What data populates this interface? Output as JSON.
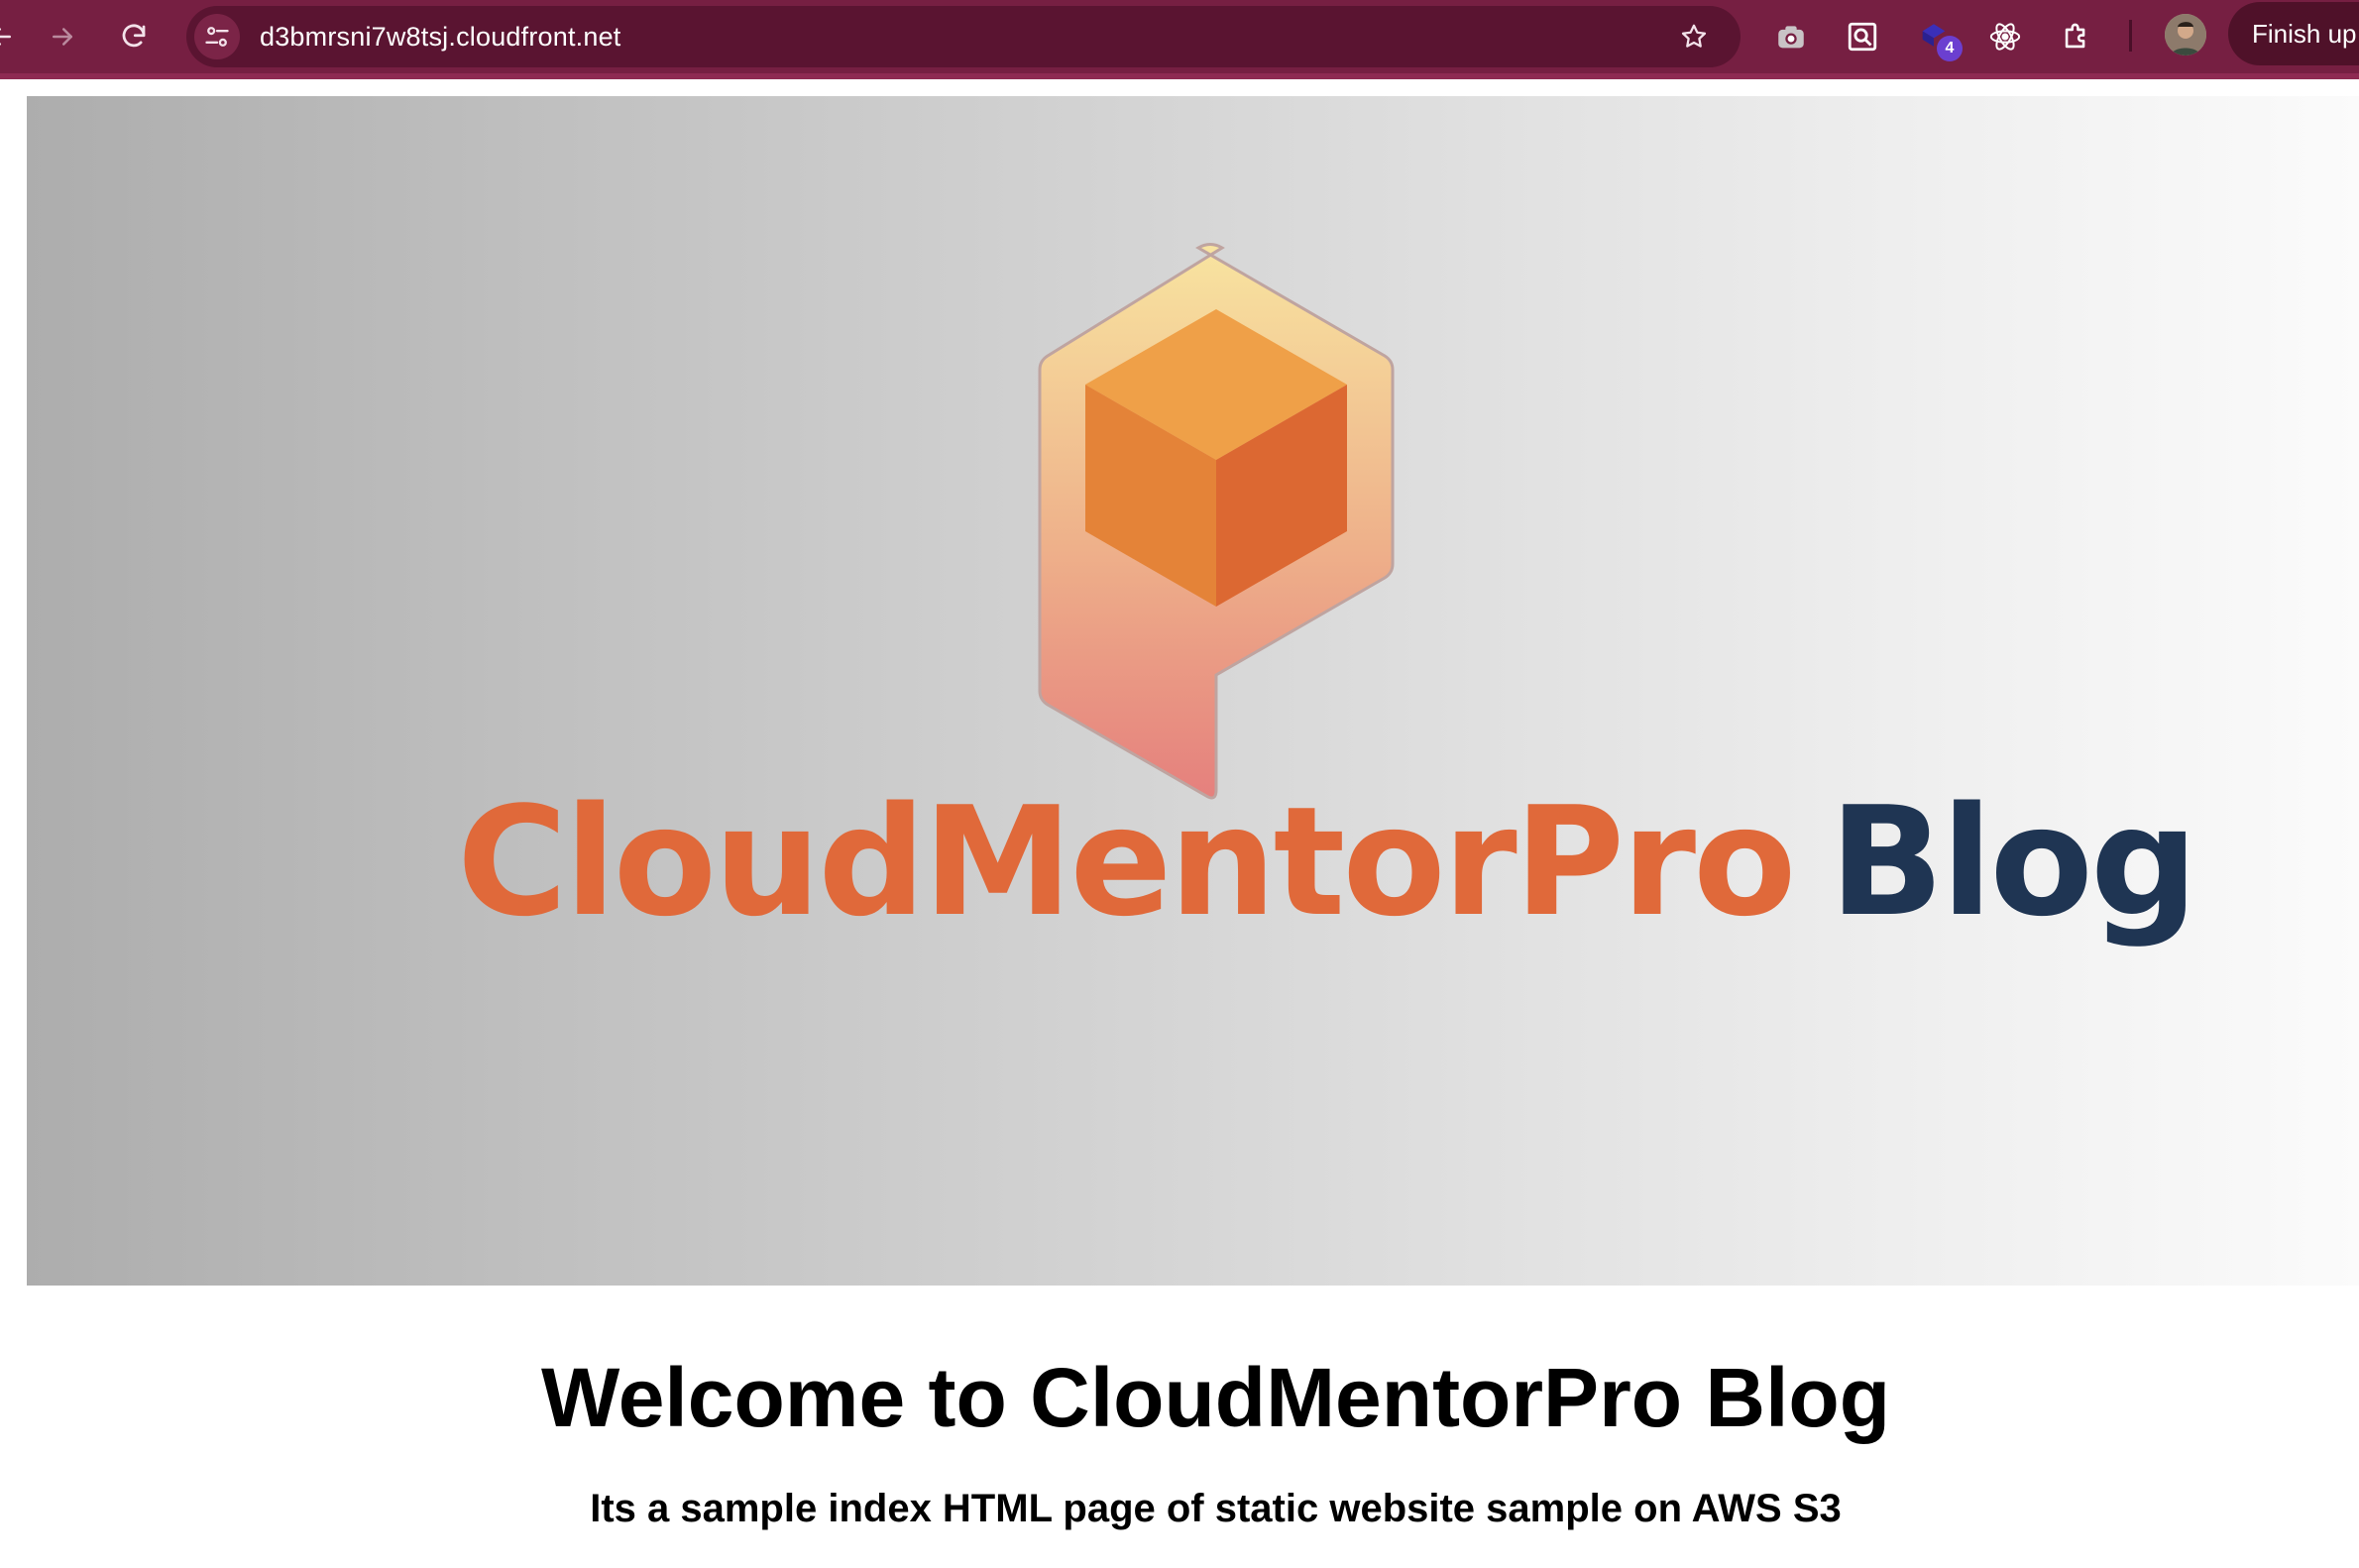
{
  "browser": {
    "url": "d3bmrsni7w8tsj.cloudfront.net",
    "finish_button_label": "Finish up",
    "extension_badge_count": "4",
    "icons": {
      "back": "back-arrow-icon",
      "forward": "forward-arrow-icon",
      "reload": "reload-icon",
      "site_info": "site-settings-icon",
      "bookmark": "star-icon",
      "camera": "camera-icon",
      "inspect": "inspect-icon",
      "extension": "extension-badge-icon",
      "react": "react-icon",
      "puzzle": "puzzle-icon",
      "profile": "avatar"
    },
    "theme_color": "#761f42"
  },
  "page": {
    "hero": {
      "logo_text_part1": "CloudMentorPro",
      "logo_text_part2": "Blog",
      "logo_colors": {
        "orange": "#e0693a",
        "navy": "#1f3553"
      }
    },
    "heading": "Welcome to CloudMentorPro Blog",
    "subheading": "Its a sample index HTML page of static website sample on AWS S3"
  }
}
